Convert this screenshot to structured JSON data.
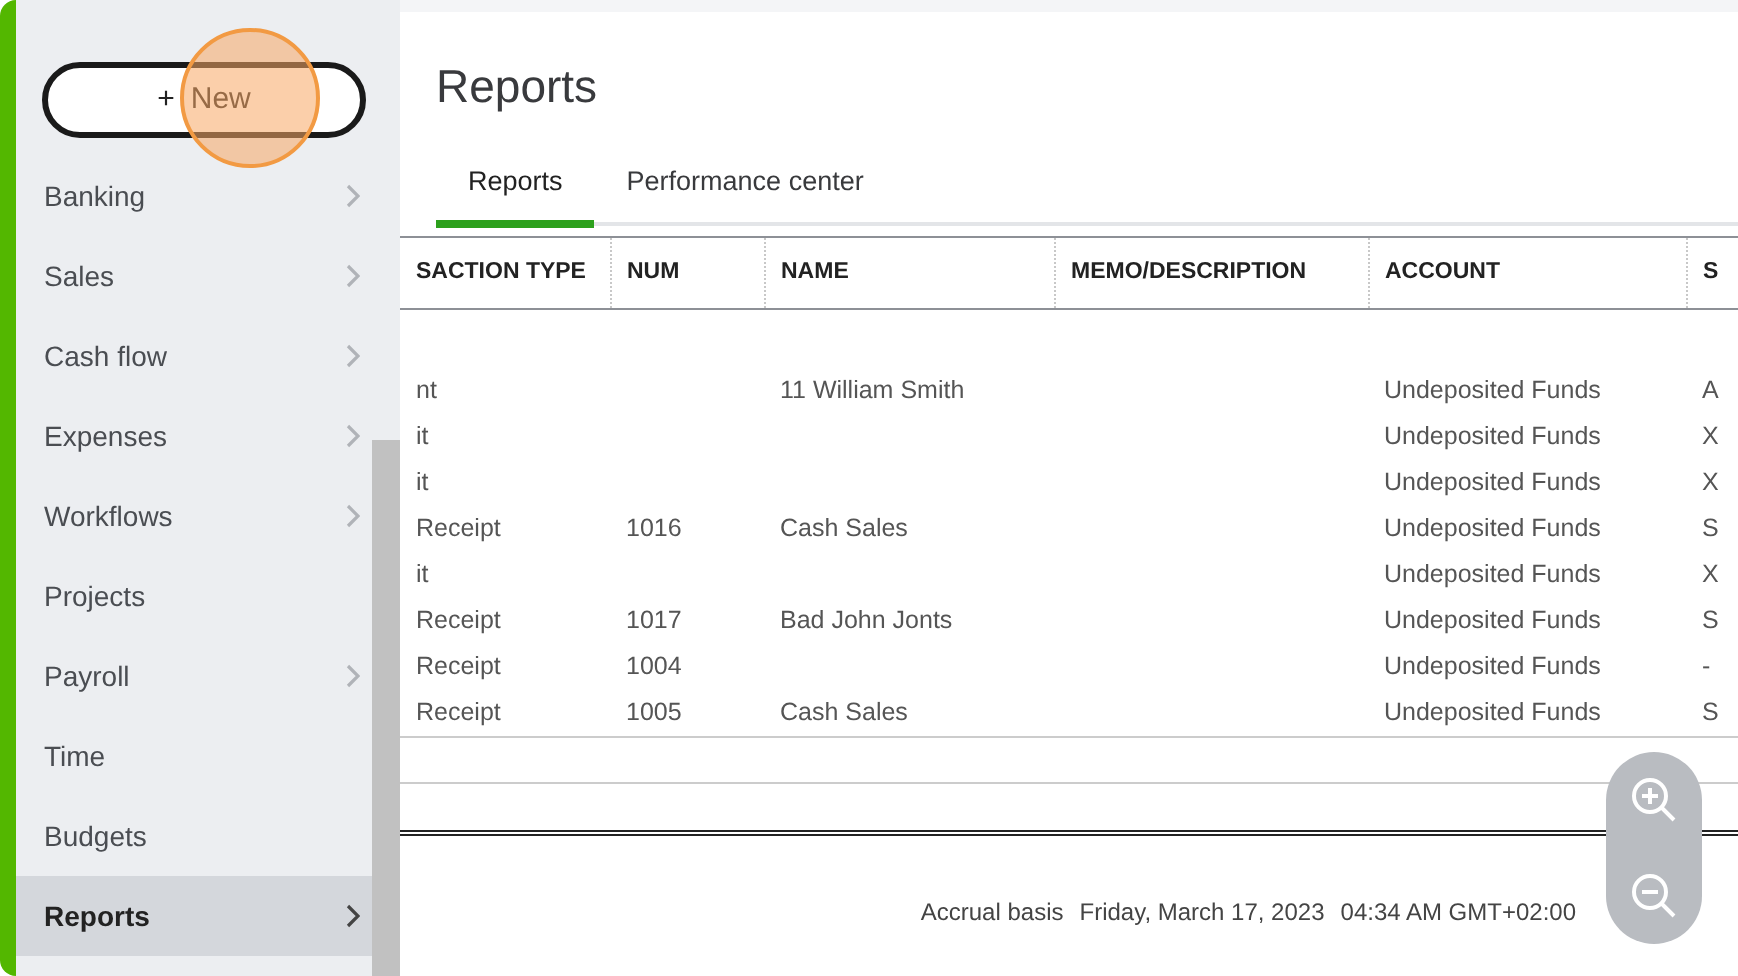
{
  "new_button": {
    "label": "New",
    "icon": "+"
  },
  "sidebar": {
    "items": [
      {
        "label": "Banking",
        "selected": false,
        "has_submenu": true
      },
      {
        "label": "Sales",
        "selected": false,
        "has_submenu": true
      },
      {
        "label": "Cash flow",
        "selected": false,
        "has_submenu": true
      },
      {
        "label": "Expenses",
        "selected": false,
        "has_submenu": true
      },
      {
        "label": "Workflows",
        "selected": false,
        "has_submenu": true
      },
      {
        "label": "Projects",
        "selected": false,
        "has_submenu": false
      },
      {
        "label": "Payroll",
        "selected": false,
        "has_submenu": true
      },
      {
        "label": "Time",
        "selected": false,
        "has_submenu": false
      },
      {
        "label": "Budgets",
        "selected": false,
        "has_submenu": false
      },
      {
        "label": "Reports",
        "selected": true,
        "has_submenu": true
      }
    ]
  },
  "page_title": "Reports",
  "tabs": [
    {
      "label": "Reports",
      "selected": true
    },
    {
      "label": "Performance center",
      "selected": false
    }
  ],
  "table": {
    "columns": [
      "SACTION TYPE",
      "NUM",
      "NAME",
      "MEMO/DESCRIPTION",
      "ACCOUNT",
      "S"
    ],
    "rows": [
      [
        "nt",
        "",
        "11 William Smith",
        "",
        "Undeposited Funds",
        "A"
      ],
      [
        "it",
        "",
        "",
        "",
        "Undeposited Funds",
        "X"
      ],
      [
        "it",
        "",
        "",
        "",
        "Undeposited Funds",
        "X"
      ],
      [
        "Receipt",
        "1016",
        "Cash Sales",
        "",
        "Undeposited Funds",
        "S"
      ],
      [
        "it",
        "",
        "",
        "",
        "Undeposited Funds",
        "X"
      ],
      [
        "Receipt",
        "1017",
        "Bad John Jonts",
        "",
        "Undeposited Funds",
        "S"
      ],
      [
        "Receipt",
        "1004",
        "",
        "",
        "Undeposited Funds",
        "-"
      ],
      [
        "Receipt",
        "1005",
        "Cash Sales",
        "",
        "Undeposited Funds",
        "S"
      ]
    ]
  },
  "footer": [
    "Accrual basis",
    "Friday, March 17, 2023",
    "04:34 AM GMT+02:00"
  ]
}
